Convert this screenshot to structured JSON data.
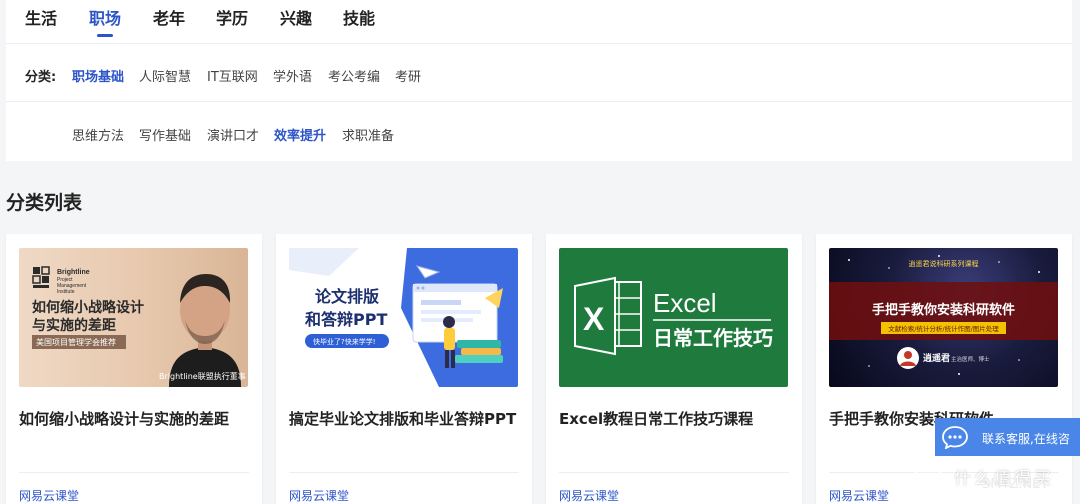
{
  "tabs": [
    {
      "label": "生活",
      "active": false
    },
    {
      "label": "职场",
      "active": true
    },
    {
      "label": "老年",
      "active": false
    },
    {
      "label": "学历",
      "active": false
    },
    {
      "label": "兴趣",
      "active": false
    },
    {
      "label": "技能",
      "active": false
    }
  ],
  "category": {
    "label": "分类:",
    "primary": [
      "职场基础",
      "人际智慧",
      "IT互联网",
      "学外语",
      "考公考编",
      "考研"
    ],
    "primary_active": "职场基础",
    "secondary": [
      "思维方法",
      "写作基础",
      "演讲口才",
      "效率提升",
      "求职准备"
    ],
    "secondary_active": "效率提升"
  },
  "section_title": "分类列表",
  "courses": [
    {
      "title": "如何缩小战略设计与实施的差距",
      "source": "网易云课堂",
      "thumb": {
        "brand_lines": [
          "Brightline",
          "Project",
          "Management",
          "Institute"
        ],
        "headline_lines": [
          "如何缩小战略设计",
          "与实施的差距"
        ],
        "tag": "美国项目管理学会推荐",
        "caption": "Brightline联盟执行董事"
      }
    },
    {
      "title": "搞定毕业论文排版和毕业答辩PPT",
      "source": "网易云课堂",
      "thumb": {
        "headline_lines": [
          "论文排版",
          "和答辩PPT"
        ],
        "tag": "快毕业了?快来学学!"
      }
    },
    {
      "title": "Excel教程日常工作技巧课程",
      "source": "网易云课堂",
      "thumb": {
        "logo_letter": "X",
        "headline_lines": [
          "Excel",
          "日常工作技巧"
        ]
      }
    },
    {
      "title": "手把手教你安装科研软件",
      "source": "网易云课堂",
      "thumb": {
        "top_label": "逍遥君说科研系列课程",
        "headline": "手把手教你安装科研软件",
        "subtitle": "文献检索/统计分析/统计作图/图片处理",
        "author": "逍遥君",
        "author_note": "主治医师、博士"
      }
    }
  ],
  "contact": {
    "label": "联系客服,在线咨"
  },
  "watermark": {
    "text": "什么值得买",
    "sub": "SMYZ.NET"
  },
  "colors": {
    "accent": "#2d55c8",
    "contact_bg": "#4a86e8",
    "excel_green": "#1f7a3e"
  }
}
